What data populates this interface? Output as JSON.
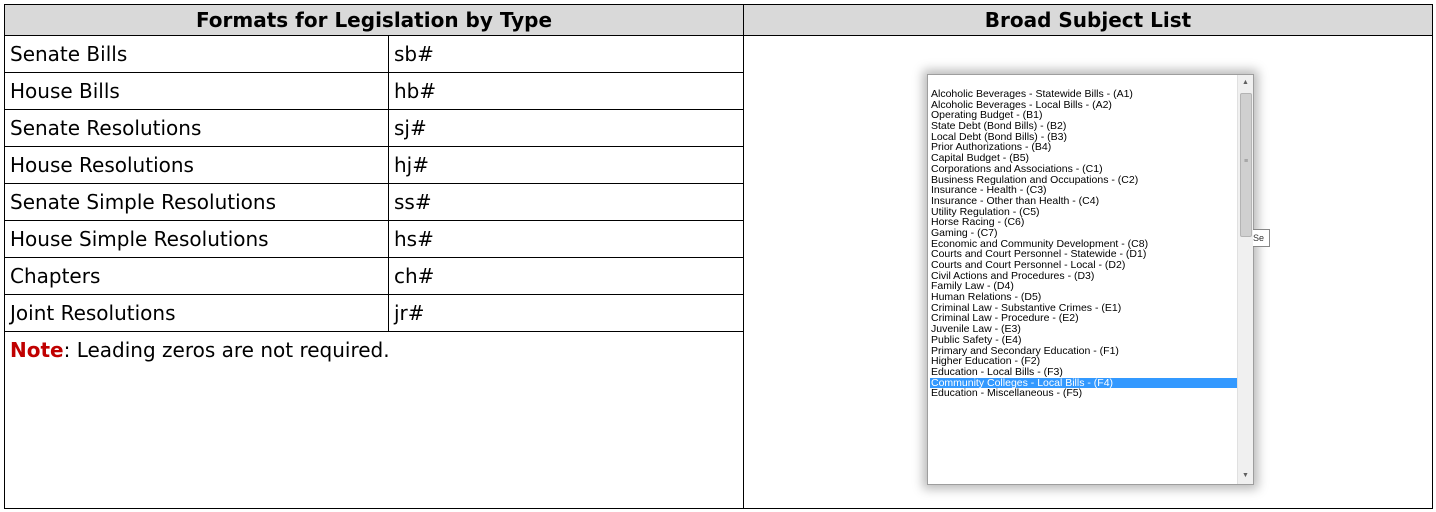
{
  "headers": {
    "left": "Formats for Legislation by Type",
    "right": "Broad Subject List"
  },
  "formats": [
    {
      "type": "Senate Bills",
      "format": "sb#"
    },
    {
      "type": "House Bills",
      "format": "hb#"
    },
    {
      "type": "Senate Resolutions",
      "format": "sj#"
    },
    {
      "type": "House Resolutions",
      "format": "hj#"
    },
    {
      "type": "Senate Simple Resolutions",
      "format": "ss#"
    },
    {
      "type": "House Simple Resolutions",
      "format": "hs#"
    },
    {
      "type": "Chapters",
      "format": "ch#"
    },
    {
      "type": "Joint Resolutions",
      "format": "jr#"
    }
  ],
  "note": {
    "label": "Note",
    "text": ": Leading zeros are not required."
  },
  "subject_list": {
    "items": [
      "Alcoholic Beverages - Statewide Bills - (A1)",
      "Alcoholic Beverages - Local Bills - (A2)",
      "Operating Budget - (B1)",
      "State Debt (Bond Bills) - (B2)",
      "Local Debt (Bond Bills) - (B3)",
      "Prior Authorizations - (B4)",
      "Capital Budget - (B5)",
      "Corporations and Associations - (C1)",
      "Business Regulation and Occupations - (C2)",
      "Insurance - Health - (C3)",
      "Insurance - Other than Health - (C4)",
      "Utility Regulation - (C5)",
      "Horse Racing - (C6)",
      "Gaming - (C7)",
      "Economic and Community Development - (C8)",
      "Courts and Court Personnel - Statewide - (D1)",
      "Courts and Court Personnel - Local - (D2)",
      "Civil Actions and Procedures - (D3)",
      "Family Law - (D4)",
      "Human Relations - (D5)",
      "Criminal Law - Substantive Crimes - (E1)",
      "Criminal Law - Procedure - (E2)",
      "Juvenile Law - (E3)",
      "Public Safety - (E4)",
      "Primary and Secondary Education - (F1)",
      "Higher Education - (F2)",
      "Education - Local Bills - (F3)",
      "Community Colleges - Local Bills - (F4)",
      "Education - Miscellaneous - (F5)"
    ],
    "selected_index": 27,
    "selected_color": "#3399ff",
    "tooltip_fragment": "Se"
  },
  "colors": {
    "header_bg": "#d9d9d9",
    "note_label": "#c00000"
  }
}
